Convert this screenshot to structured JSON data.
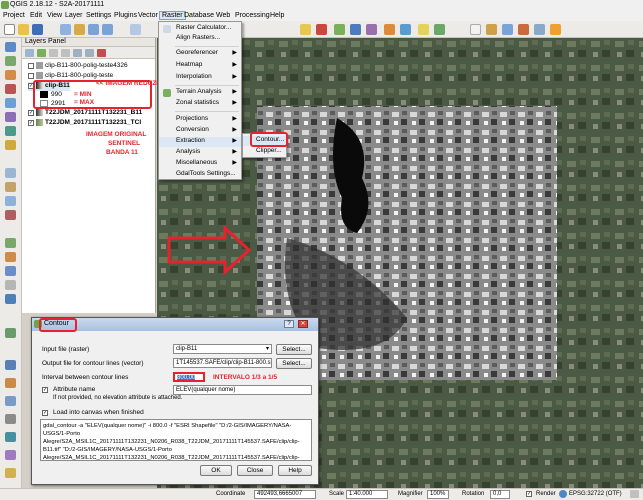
{
  "window": {
    "title": "QGIS 2.18.12 - S2A-20171111"
  },
  "menubar": [
    "Project",
    "Edit",
    "View",
    "Layer",
    "Settings",
    "Plugins",
    "Vector",
    "Raster",
    "Database",
    "Web",
    "Processing",
    "Help"
  ],
  "layers_panel": {
    "title": "Layers Panel",
    "layers": [
      {
        "name": "clip-B11-800-polig-teste4326",
        "checked": false
      },
      {
        "name": "clip-B11-800-polig-teste",
        "checked": false
      },
      {
        "name": "clip-B11",
        "checked": true
      },
      {
        "name": "T22JDM_20171111T132231_B11",
        "checked": true
      },
      {
        "name": "T22JDM_20171111T132231_TCI",
        "checked": true
      }
    ],
    "legend_min": "990",
    "legend_max": "2991"
  },
  "annotations": {
    "imagem_reduzida": "<< IMAGEM REDUZIDA",
    "min": "= MIN",
    "max": "= MAX",
    "imagem_original": "IMAGEM ORIGINAL",
    "sentinel": "SENTINEL",
    "banda": "BANDA 11",
    "intervalo": "INTERVALO 1/3 a 1/5"
  },
  "raster_menu": {
    "items": [
      {
        "label": "Raster Calculator...",
        "submenu": false
      },
      {
        "label": "Align Rasters...",
        "submenu": false
      },
      {
        "label": "Georeferencer",
        "submenu": true
      },
      {
        "label": "Heatmap",
        "submenu": true
      },
      {
        "label": "Interpolation",
        "submenu": true
      },
      {
        "label": "Terrain Analysis",
        "submenu": true
      },
      {
        "label": "Zonal statistics",
        "submenu": true
      },
      {
        "label": "Projections",
        "submenu": true
      },
      {
        "label": "Conversion",
        "submenu": true
      },
      {
        "label": "Extraction",
        "submenu": true
      },
      {
        "label": "Analysis",
        "submenu": true
      },
      {
        "label": "Miscellaneous",
        "submenu": true
      },
      {
        "label": "GdalTools Settings...",
        "submenu": false
      }
    ],
    "extraction_submenu": [
      "Contour...",
      "Clipper..."
    ]
  },
  "contour_dialog": {
    "title": "Contour",
    "input_label": "Input file (raster)",
    "input_value": "clip-B11",
    "output_label": "Output file for contour lines (vector)",
    "output_value": "1T145537.SAFE/clip/clip-B11-800.shp",
    "interval_label": "Interval between contour lines",
    "interval_value": "800,00",
    "attribute_label": "Attribute name",
    "attribute_value": "ELEV(qualquer nome)",
    "attribute_note": "If not provided, no elevation attribute is attached.",
    "load_label": "Load into canvas when finished",
    "select_label": "Select...",
    "command": "gdal_contour -a \"ELEV(qualquer nome)\" -i 800.0 -f \"ESRI Shapefile\" \"D:/2-GIS/IMAGERY/NASA-USGS/1-Porto Alegre/S2A_MSIL1C_20171111T132231_N0206_R038_T22JDM_20171111T145537.SAFE/clip/clip-B11.tif\" \"D:/2-GIS/IMAGERY/NASA-USGS/1-Porto Alegre/S2A_MSIL1C_20171111T132231_N0206_R038_T22JDM_20171111T145537.SAFE/clip/clip-B11-800.shp\"",
    "ok": "OK",
    "close": "Close",
    "help": "Help"
  },
  "statusbar": {
    "coordinate_label": "Coordinate",
    "coordinate_value": "492493,6665007",
    "scale_label": "Scale",
    "scale_value": "1:40.000",
    "magnifier_label": "Magnifier",
    "magnifier_value": "100%",
    "rotation_label": "Rotation",
    "rotation_value": "0,0",
    "render_label": "Render",
    "crs_label": "EPSG:32722 (OTF)"
  },
  "colors": {
    "annotation": "#e8222d",
    "dialog_title": "#a8c1e2"
  }
}
